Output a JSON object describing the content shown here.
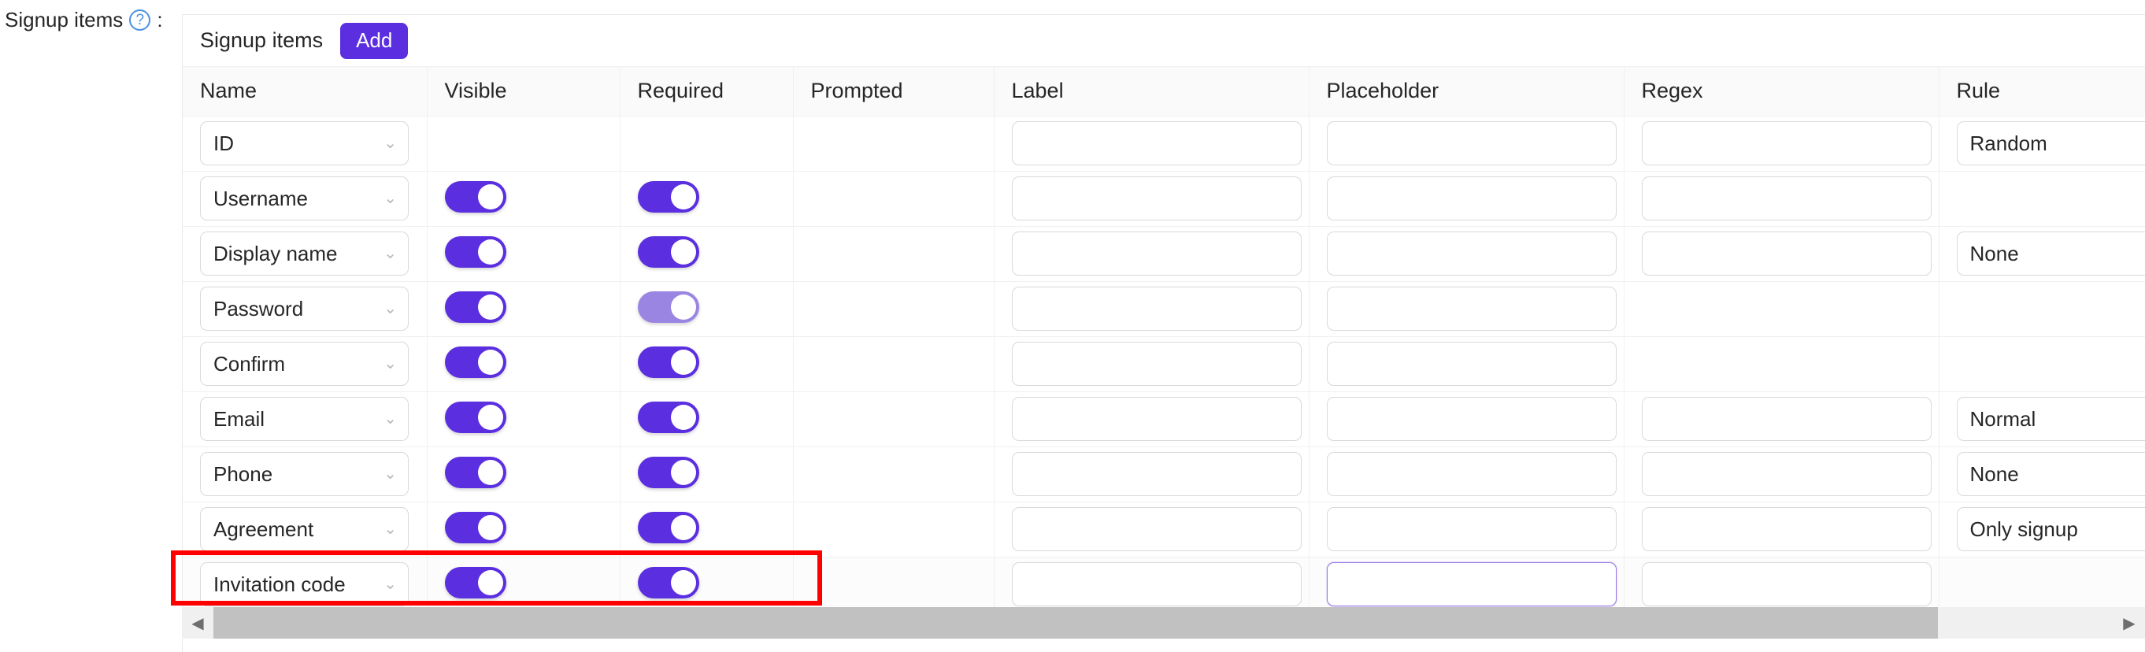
{
  "form": {
    "label": "Signup items",
    "help_icon": "question-circle-icon",
    "colon": ":"
  },
  "card": {
    "title": "Signup items",
    "add_label": "Add"
  },
  "table": {
    "columns": [
      "Name",
      "Visible",
      "Required",
      "Prompted",
      "Label",
      "Placeholder",
      "Regex",
      "Rule"
    ],
    "rows": [
      {
        "name": "ID",
        "visible": null,
        "required": null,
        "prompted": null,
        "label": "",
        "placeholder": "",
        "regex": "",
        "rule": "Random",
        "highlighted": false,
        "focused_field": null
      },
      {
        "name": "Username",
        "visible": true,
        "required": true,
        "prompted": null,
        "label": "",
        "placeholder": "",
        "regex": "",
        "rule": null,
        "highlighted": false,
        "focused_field": null
      },
      {
        "name": "Display name",
        "visible": true,
        "required": true,
        "prompted": null,
        "label": "",
        "placeholder": "",
        "regex": "",
        "rule": "None",
        "highlighted": false,
        "focused_field": null
      },
      {
        "name": "Password",
        "visible": true,
        "required": true,
        "required_disabled": true,
        "prompted": null,
        "label": "",
        "placeholder": "",
        "regex": null,
        "rule": null,
        "highlighted": false,
        "focused_field": null
      },
      {
        "name": "Confirm",
        "visible": true,
        "required": true,
        "prompted": null,
        "label": "",
        "placeholder": "",
        "regex": null,
        "rule": null,
        "highlighted": false,
        "focused_field": null
      },
      {
        "name": "Email",
        "visible": true,
        "required": true,
        "prompted": null,
        "label": "",
        "placeholder": "",
        "regex": "",
        "rule": "Normal",
        "highlighted": false,
        "focused_field": null
      },
      {
        "name": "Phone",
        "visible": true,
        "required": true,
        "prompted": null,
        "label": "",
        "placeholder": "",
        "regex": "",
        "rule": "None",
        "highlighted": false,
        "focused_field": null
      },
      {
        "name": "Agreement",
        "visible": true,
        "required": true,
        "prompted": null,
        "label": "",
        "placeholder": "",
        "regex": "",
        "rule": "Only signup",
        "highlighted": false,
        "focused_field": null
      },
      {
        "name": "Invitation code",
        "visible": true,
        "required": true,
        "prompted": null,
        "label": "",
        "placeholder": "",
        "regex": "",
        "rule": null,
        "highlighted": true,
        "focused_field": "placeholder"
      }
    ]
  },
  "scrollbar": {
    "left_arrow": "◀",
    "right_arrow": "▶"
  },
  "colors": {
    "accent": "#5b2fe0",
    "accent_disabled": "#9a85e3",
    "annotation": "#ff0000",
    "focus_border": "#9a7ae8",
    "help_icon": "#4a90e2"
  },
  "icons": {
    "chevron_down": "⌄"
  }
}
